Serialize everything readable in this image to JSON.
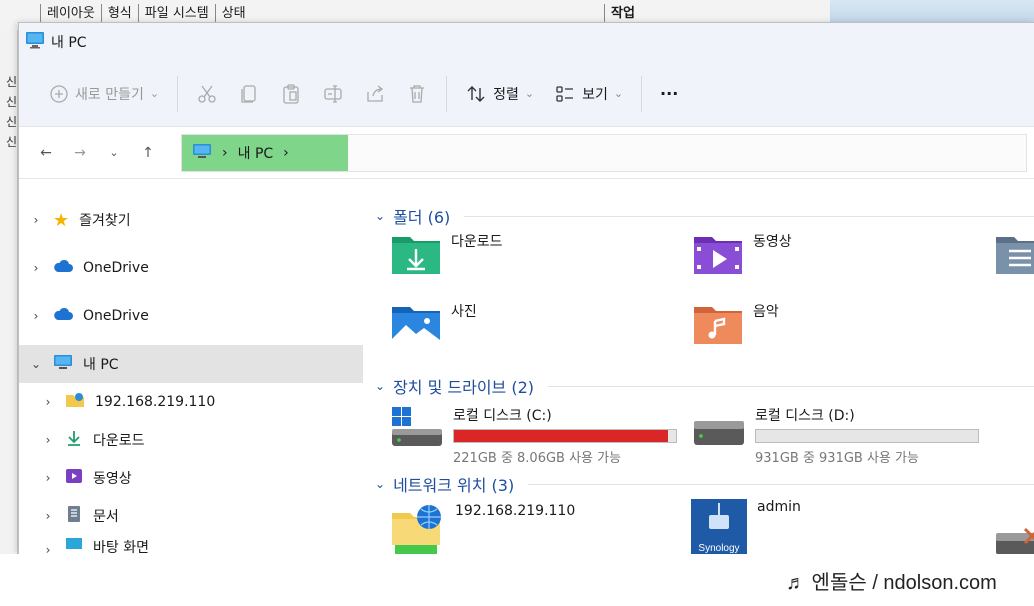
{
  "background": {
    "columns": [
      "레이아웃",
      "형식",
      "파일 시스템",
      "상태"
    ],
    "work_col": "작업",
    "left_strip": [
      "신",
      "신",
      "신",
      "신"
    ]
  },
  "window": {
    "title": "내 PC"
  },
  "toolbar": {
    "new_label": "새로 만들기",
    "sort_label": "정렬",
    "view_label": "보기",
    "more_label": "···"
  },
  "address": {
    "crumb": "내 PC"
  },
  "nav": {
    "items": [
      {
        "label": "즐겨찾기"
      },
      {
        "label": "OneDrive"
      },
      {
        "label": "OneDrive"
      },
      {
        "label": "내 PC"
      },
      {
        "label": "192.168.219.110"
      },
      {
        "label": "다운로드"
      },
      {
        "label": "동영상"
      },
      {
        "label": "문서"
      },
      {
        "label": "바탕 화면"
      }
    ]
  },
  "sections": {
    "folders": "폴더 (6)",
    "drives": "장치 및 드라이브 (2)",
    "network": "네트워크 위치 (3)"
  },
  "folders": [
    "다운로드",
    "동영상",
    "사진",
    "음악"
  ],
  "drives": [
    {
      "name": "로컬 디스크 (C:)",
      "detail": "221GB 중 8.06GB 사용 가능",
      "used_fraction": 0.964
    },
    {
      "name": "로컬 디스크 (D:)",
      "detail": "931GB 중 931GB 사용 가능",
      "used_fraction": 0.0
    }
  ],
  "network": [
    "192.168.219.110",
    "admin"
  ],
  "watermark": "♬ 엔돌슨 / ndolson.com",
  "colors": {
    "accent": "#1f4ea0",
    "highlight": "#7fd68a",
    "drive_full": "#da2626"
  }
}
